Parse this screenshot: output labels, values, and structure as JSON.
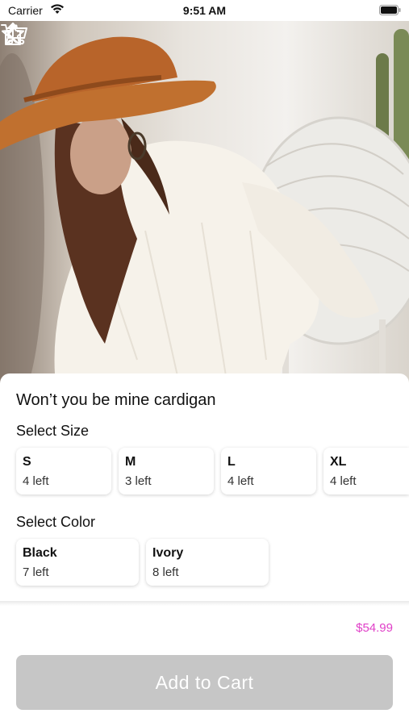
{
  "status_bar": {
    "carrier": "Carrier",
    "time": "9:51 AM"
  },
  "product": {
    "title": "Won’t you be mine cardigan",
    "price": "$54.99"
  },
  "size_section": {
    "label": "Select Size",
    "options": [
      {
        "name": "S",
        "stock": "4 left"
      },
      {
        "name": "M",
        "stock": "3 left"
      },
      {
        "name": "L",
        "stock": "4 left"
      },
      {
        "name": "XL",
        "stock": "4 left"
      }
    ]
  },
  "color_section": {
    "label": "Select Color",
    "options": [
      {
        "name": "Black",
        "stock": "7 left"
      },
      {
        "name": "Ivory",
        "stock": "8 left"
      }
    ]
  },
  "actions": {
    "add_to_cart": "Add to Cart"
  },
  "icons": {
    "back": "chevron-left-icon",
    "favorite": "star-icon",
    "share": "share-icon",
    "cart": "cart-icon"
  },
  "colors": {
    "price": "#e040c8",
    "button_disabled": "#c6c6c6"
  }
}
